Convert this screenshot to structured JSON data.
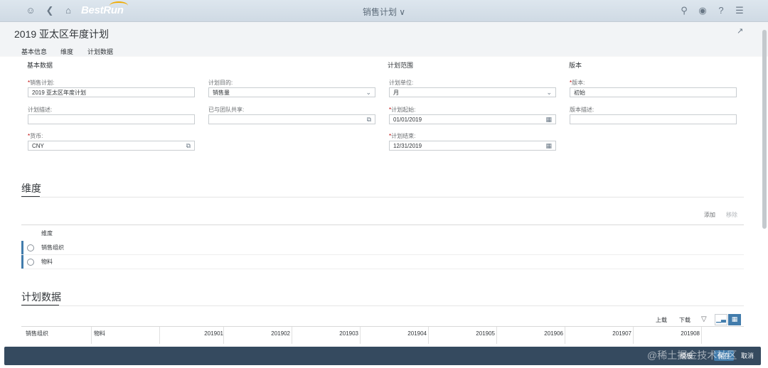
{
  "shell": {
    "logo": "BestRun",
    "title": "销售计划 ∨"
  },
  "page": {
    "title": "2019 亚太区年度计划",
    "tabs": [
      "基本信息",
      "维度",
      "计划数据"
    ]
  },
  "basic": {
    "section_basic": "基本数据",
    "section_range": "计划范围",
    "section_version": "版本",
    "sales_plan_label": "销售计划:",
    "sales_plan_value": "2019 亚太区年度计划",
    "plan_desc_label": "计划描述:",
    "plan_desc_value": "",
    "currency_label": "货币:",
    "currency_value": "CNY",
    "plan_target_label": "计划目的:",
    "plan_target_value": "销售量",
    "shared_label": "已与团队共享:",
    "shared_value": "",
    "plan_unit_label": "计划单位:",
    "plan_unit_value": "月",
    "plan_start_label": "计划起始:",
    "plan_start_value": "01/01/2019",
    "plan_end_label": "计划结束:",
    "plan_end_value": "12/31/2019",
    "version_label": "版本:",
    "version_value": "初始",
    "version_desc_label": "版本描述:",
    "version_desc_value": ""
  },
  "dimensions": {
    "title": "维度",
    "add": "添加",
    "remove": "移除",
    "column": "维度",
    "rows": [
      "销售组织",
      "物料"
    ]
  },
  "plan_data": {
    "title": "计划数据",
    "upload": "上载",
    "download": "下载",
    "columns": [
      "销售组织",
      "物料",
      "201901",
      "201902",
      "201903",
      "201904",
      "201905",
      "201906",
      "201907",
      "201908"
    ]
  },
  "footer": {
    "buttons": [
      "模板",
      "保存",
      "取消"
    ]
  },
  "watermark": "@稀土掘金技术社区",
  "colors": {
    "accent": "#427cac",
    "required": "#bb0000",
    "footer": "#354a5f"
  }
}
